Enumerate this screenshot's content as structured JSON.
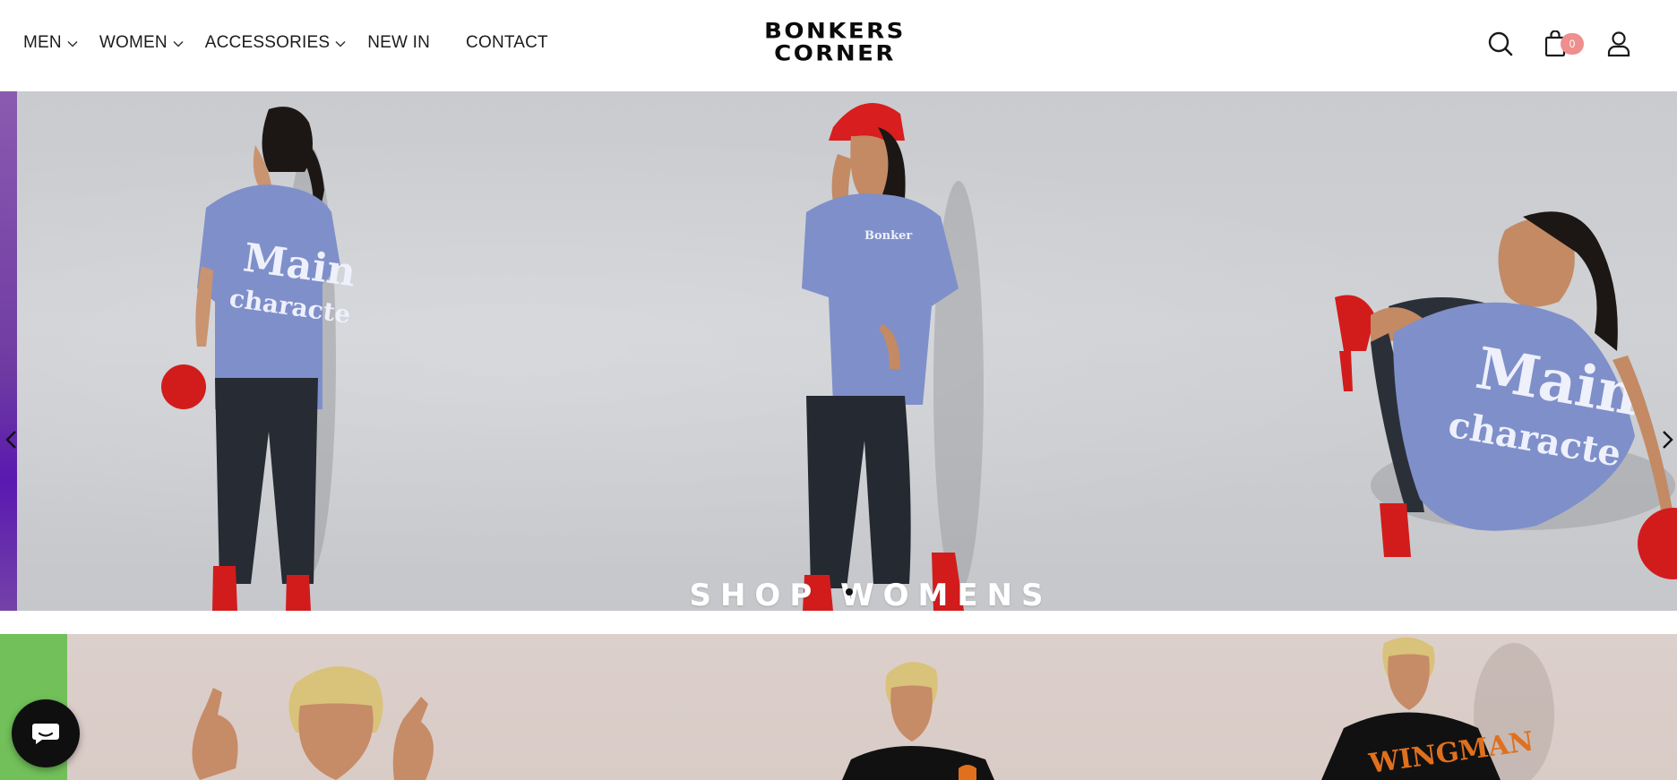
{
  "nav": {
    "items": [
      {
        "label": "MEN",
        "has_dropdown": true
      },
      {
        "label": "WOMEN",
        "has_dropdown": true
      },
      {
        "label": "ACCESSORIES",
        "has_dropdown": true
      },
      {
        "label": "NEW IN",
        "has_dropdown": false
      },
      {
        "label": "CONTACT",
        "has_dropdown": false
      }
    ]
  },
  "logo": {
    "line1": "BONKERS",
    "line2": "CORNER"
  },
  "header_icons": {
    "search": "search-icon",
    "cart": "shopping-bag-icon",
    "cart_count": "0",
    "account": "user-icon"
  },
  "hero": {
    "cta_label": "SHOP WOMENS",
    "prev_icon": "chevron-left-icon",
    "next_icon": "chevron-right-icon",
    "slides_total": 1,
    "active_slide": 1,
    "colors": {
      "strip": "#6e3aa2",
      "wall": "#cbcdd1",
      "shirt": "#7d8dc7",
      "pants": "#2a2f38",
      "accent_red": "#d81e1e"
    }
  },
  "hero2": {
    "colors": {
      "strip": "#72c05a",
      "wall": "#dacdc8",
      "shirt": "#111111",
      "print": "#e0701e"
    }
  },
  "chat": {
    "icon": "chat-bubble-icon"
  }
}
